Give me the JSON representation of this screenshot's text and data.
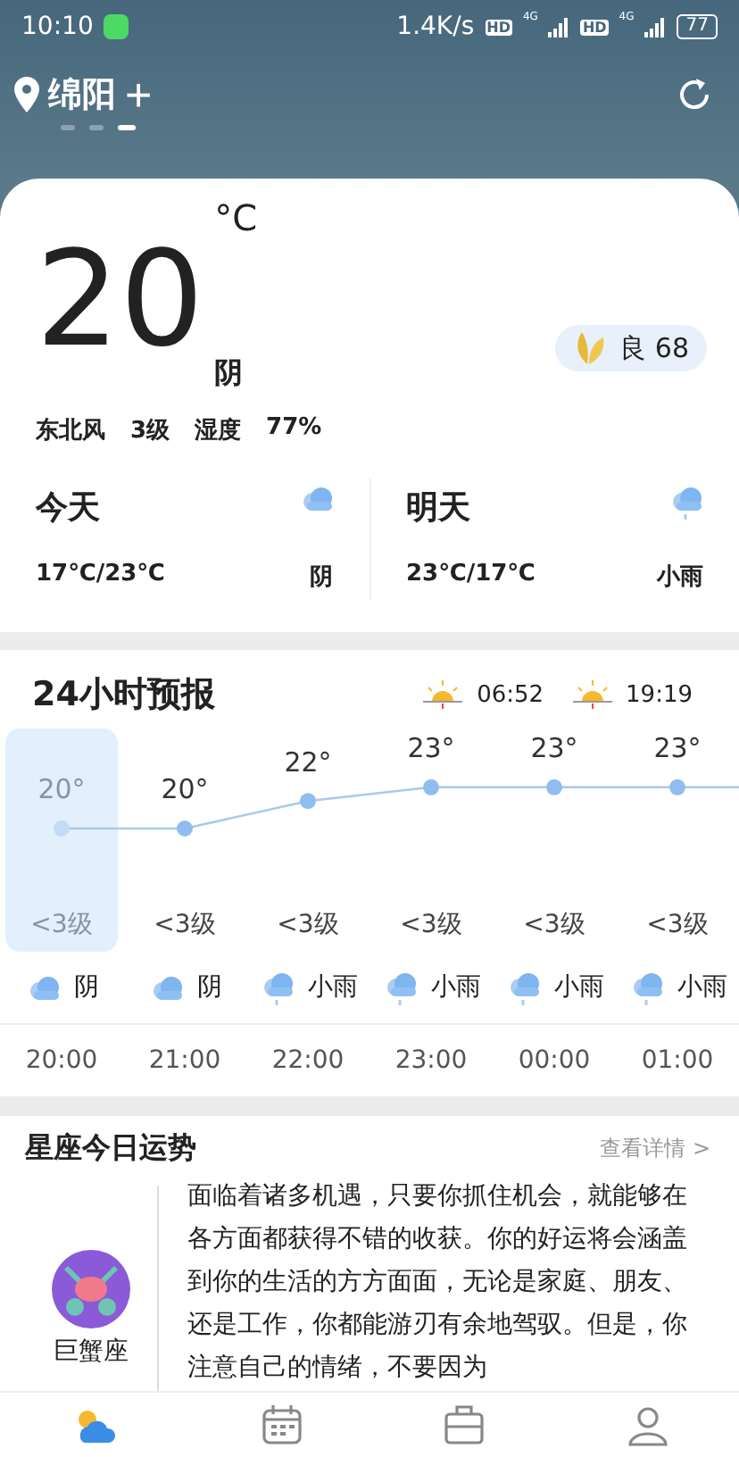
{
  "status_bar": {
    "time": "10:10",
    "speed": "1.4K/s",
    "sims": [
      {
        "hd": "HD",
        "net": "4G"
      },
      {
        "hd": "HD",
        "net": "4G"
      }
    ],
    "battery": "77"
  },
  "header": {
    "city": "绵阳",
    "add": "+",
    "pages": [
      {
        "selected": false
      },
      {
        "selected": false
      },
      {
        "selected": true
      }
    ]
  },
  "current": {
    "temp": "20",
    "unit": "°C",
    "condition": "阴",
    "aqi": "良 68",
    "wind_dir": "东北风",
    "wind_level": "3级",
    "humidity_label": "湿度",
    "humidity": "77%"
  },
  "days": [
    {
      "label": "今天",
      "range": "17℃/23℃",
      "condition": "阴",
      "kind": "cloudy"
    },
    {
      "label": "明天",
      "range": "23℃/17℃",
      "condition": "小雨",
      "kind": "rain"
    }
  ],
  "hourly": {
    "title": "24小时预报",
    "sunrise": "06:52",
    "sunset": "19:19",
    "hours": [
      {
        "temp": "20°",
        "wind": "<3级",
        "condition": "阴",
        "kind": "cloudy",
        "time": "20:00",
        "selected": true
      },
      {
        "temp": "20°",
        "wind": "<3级",
        "condition": "阴",
        "kind": "cloudy",
        "time": "21:00",
        "selected": false
      },
      {
        "temp": "22°",
        "wind": "<3级",
        "condition": "小雨",
        "kind": "rain",
        "time": "22:00",
        "selected": false
      },
      {
        "temp": "23°",
        "wind": "<3级",
        "condition": "小雨",
        "kind": "rain",
        "time": "23:00",
        "selected": false
      },
      {
        "temp": "23°",
        "wind": "<3级",
        "condition": "小雨",
        "kind": "rain",
        "time": "00:00",
        "selected": false
      },
      {
        "temp": "23°",
        "wind": "<3级",
        "condition": "小雨",
        "kind": "rain",
        "time": "01:00",
        "selected": false
      }
    ]
  },
  "horoscope": {
    "title": "星座今日运势",
    "more": "查看详情 >",
    "sign": "巨蟹座",
    "text": "面临着诸多机遇，只要你抓住机会，就能够在各方面都获得不错的收获。你的好运将会涵盖到你的生活的方方面面，无论是家庭、朋友、还是工作，你都能游刃有余地驾驭。但是，你注意自己的情绪，不要因为"
  },
  "tabs": [
    {
      "kind": "weather",
      "selected": true
    },
    {
      "kind": "calendar",
      "selected": false
    },
    {
      "kind": "tools",
      "selected": false
    },
    {
      "kind": "profile",
      "selected": false
    }
  ]
}
